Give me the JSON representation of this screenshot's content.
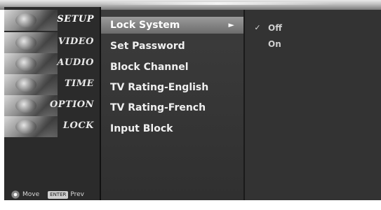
{
  "sidebar": {
    "categories": [
      {
        "label": "SETUP",
        "active": true
      },
      {
        "label": "VIDEO",
        "active": false
      },
      {
        "label": "AUDIO",
        "active": false
      },
      {
        "label": "TIME",
        "active": false
      },
      {
        "label": "OPTION",
        "active": false
      },
      {
        "label": "LOCK",
        "active": false
      }
    ],
    "footer": {
      "move_label": "Move",
      "prev_key": "ENTER",
      "prev_label": "Prev"
    }
  },
  "menu": {
    "items": [
      {
        "label": "Lock System",
        "active": true
      },
      {
        "label": "Set Password",
        "active": false
      },
      {
        "label": "Block Channel",
        "active": false
      },
      {
        "label": "TV Rating-English",
        "active": false
      },
      {
        "label": "TV Rating-French",
        "active": false
      },
      {
        "label": "Input Block",
        "active": false
      }
    ],
    "arrow": "►"
  },
  "options": {
    "items": [
      {
        "label": "Off",
        "checked": true
      },
      {
        "label": "On",
        "checked": false
      }
    ],
    "check_glyph": "✓"
  }
}
